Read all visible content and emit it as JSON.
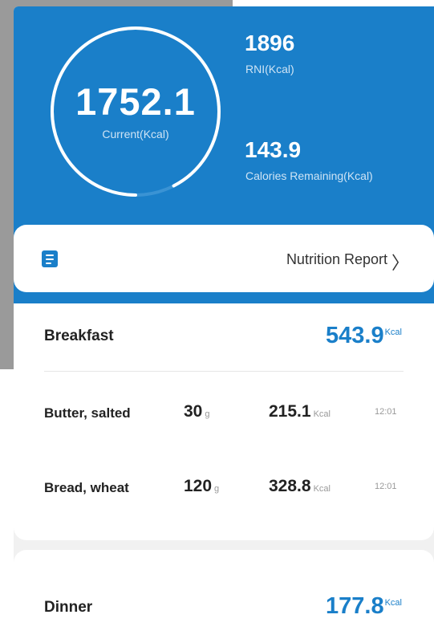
{
  "summary": {
    "current_value": "1752.1",
    "current_label": "Current(Kcal)",
    "rni_value": "1896",
    "rni_label": "RNI(Kcal)",
    "remaining_value": "143.9",
    "remaining_label": "Calories Remaining(Kcal)",
    "progress_fraction": 0.924
  },
  "report": {
    "label": "Nutrition Report",
    "icon": "document-icon",
    "chevron": "chevron-right-icon"
  },
  "meals": [
    {
      "title": "Breakfast",
      "total": "543.9",
      "unit": "Kcal",
      "items": [
        {
          "name": "Butter, salted",
          "qty": "30",
          "qty_unit": "g",
          "kcal": "215.1",
          "kcal_unit": "Kcal",
          "time": "12:01"
        },
        {
          "name": "Bread, wheat",
          "qty": "120",
          "qty_unit": "g",
          "kcal": "328.8",
          "kcal_unit": "Kcal",
          "time": "12:01"
        }
      ]
    },
    {
      "title": "Dinner",
      "total": "177.8",
      "unit": "Kcal",
      "items": []
    }
  ],
  "colors": {
    "primary": "#1a7fc9",
    "ring": "#ffffff",
    "ring_track": "#3a93d4"
  }
}
